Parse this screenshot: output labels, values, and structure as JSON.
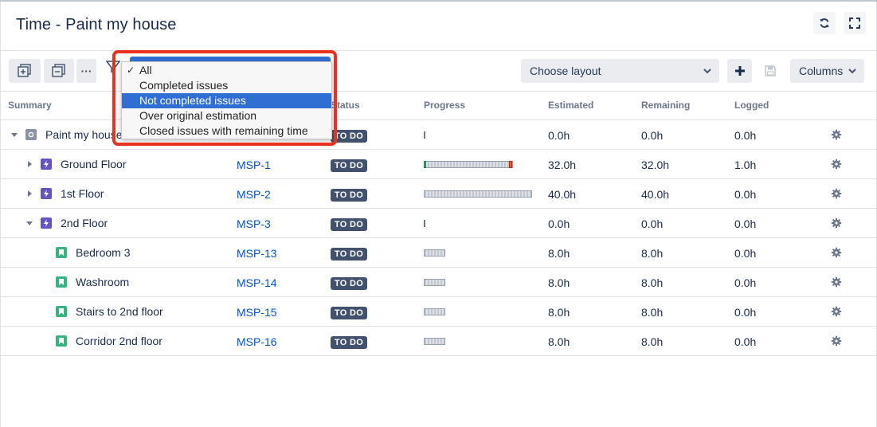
{
  "window": {
    "title": "Time - Paint my house"
  },
  "header": {
    "refresh_icon": "refresh-icon",
    "fullscreen_icon": "fullscreen-icon"
  },
  "toolbar": {
    "expand_icon": "expand-all-icon",
    "collapse_icon": "collapse-all-icon",
    "more_label": "···",
    "filter_icon": "filter-icon",
    "layout_select": {
      "value": "Choose layout"
    },
    "add_icon": "plus-icon",
    "save_icon": "save-icon",
    "columns_label": "Columns"
  },
  "filter_dropdown": {
    "options": [
      {
        "label": "All",
        "checked": true,
        "highlighted": false
      },
      {
        "label": "Completed issues",
        "checked": false,
        "highlighted": false
      },
      {
        "label": "Not completed issues",
        "checked": false,
        "highlighted": true
      },
      {
        "label": "Over original estimation",
        "checked": false,
        "highlighted": false
      },
      {
        "label": "Closed issues with remaining time",
        "checked": false,
        "highlighted": false
      }
    ],
    "check_glyph": "✓"
  },
  "columns": {
    "summary": "Summary",
    "status": "Status",
    "progress": "Progress",
    "estimated": "Estimated",
    "remaining": "Remaining",
    "logged": "Logged"
  },
  "rows": [
    {
      "summary": "Paint my house",
      "key": "",
      "status": "TO DO",
      "estimated": "0.0h",
      "remaining": "0.0h",
      "logged": "0.0h",
      "type": "project",
      "expanded": true
    },
    {
      "summary": "Ground Floor",
      "key": "MSP-1",
      "status": "TO DO",
      "estimated": "32.0h",
      "remaining": "32.0h",
      "logged": "1.0h",
      "type": "epic",
      "expanded": false
    },
    {
      "summary": "1st Floor",
      "key": "MSP-2",
      "status": "TO DO",
      "estimated": "40.0h",
      "remaining": "40.0h",
      "logged": "0.0h",
      "type": "epic",
      "expanded": false
    },
    {
      "summary": "2nd Floor",
      "key": "MSP-3",
      "status": "TO DO",
      "estimated": "0.0h",
      "remaining": "0.0h",
      "logged": "0.0h",
      "type": "epic",
      "expanded": true
    },
    {
      "summary": "Bedroom 3",
      "key": "MSP-13",
      "status": "TO DO",
      "estimated": "8.0h",
      "remaining": "8.0h",
      "logged": "0.0h",
      "type": "story"
    },
    {
      "summary": "Washroom",
      "key": "MSP-14",
      "status": "TO DO",
      "estimated": "8.0h",
      "remaining": "8.0h",
      "logged": "0.0h",
      "type": "story"
    },
    {
      "summary": "Stairs to 2nd floor",
      "key": "MSP-15",
      "status": "TO DO",
      "estimated": "8.0h",
      "remaining": "8.0h",
      "logged": "0.0h",
      "type": "story"
    },
    {
      "summary": "Corridor 2nd floor",
      "key": "MSP-16",
      "status": "TO DO",
      "estimated": "8.0h",
      "remaining": "8.0h",
      "logged": "0.0h",
      "type": "story"
    }
  ],
  "colors": {
    "epic": "#6554c0",
    "story": "#36b37e",
    "project": "#8993a4",
    "link": "#0052cc",
    "lozenge": "#42526e",
    "highlight": "#2f6fd4",
    "annotation_outline": "#e8321f"
  }
}
